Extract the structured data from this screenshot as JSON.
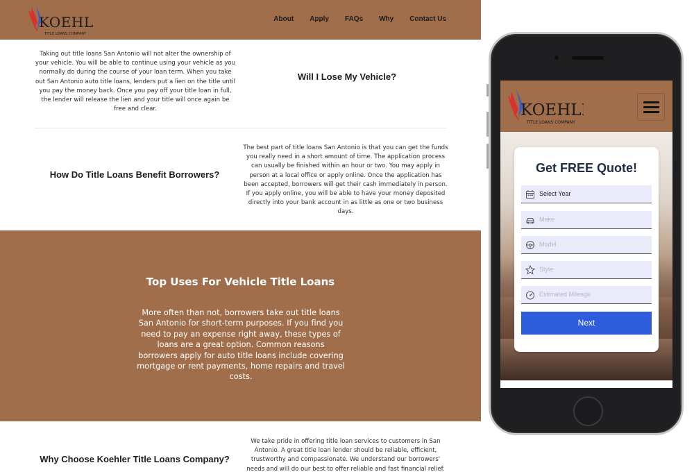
{
  "brand": {
    "logo_text": "KOEHLER",
    "logo_subtext": "TITLE LOANS COMPANY",
    "primary_color": "#a06e4b",
    "accent_red": "#d9322a",
    "accent_blue": "#3c5fc7"
  },
  "nav": {
    "items": [
      "About",
      "Apply",
      "FAQs",
      "Why",
      "Contact Us"
    ]
  },
  "sections": {
    "lose_vehicle": {
      "heading": "Will I Lose My Vehicle?",
      "text": "Taking out title loans San Antonio will not alter the ownership of your vehicle. You will be able to continue using your vehicle as you normally do during the course of your loan term. When you take out San Antonio auto title loans, lenders put a lien on the title until you pay the money back. Once you pay off your title loan in full, the lender will release the lien and your title will once again be free and clear."
    },
    "benefit": {
      "heading": "How Do Title Loans Benefit Borrowers?",
      "text": "The best part of title loans San Antonio is that you can get the funds you really need in a short amount of time. The application process can usually be finished within an hour or two. You may apply in person at a local office or apply online. Once the application has been accepted, borrowers will get their cash immediately in person. If you apply online, you will be able to have your money deposited directly into your bank account in as little as one or two business days."
    },
    "top_uses": {
      "heading": "Top Uses For Vehicle Title Loans",
      "text": "More often than not, borrowers take out title loans San Antonio for short-term purposes. If you find you need to pay an expense right away, these types of loans are a great option. Common reasons borrowers apply for auto title loans include covering mortgage or rent payments, home repairs and travel costs."
    },
    "why_choose": {
      "heading": "Why Choose Koehler Title Loans Company?",
      "text": "We take pride in offering title loan services to customers in San Antonio. A great title loan lender should be reliable, efficient, trustworthy and compassionate. We understand our borrowers' needs and will do our best to offer reliable and fast financial relief. We present all customers"
    }
  },
  "mobile": {
    "quote_title": "Get FREE Quote!",
    "fields": [
      {
        "icon": "calendar-icon",
        "value": "Select Year",
        "filled": true
      },
      {
        "icon": "car-icon",
        "value": "Make",
        "filled": false
      },
      {
        "icon": "steering-wheel-icon",
        "value": "Model",
        "filled": false
      },
      {
        "icon": "star-icon",
        "value": "Style",
        "filled": false
      },
      {
        "icon": "speedometer-icon",
        "value": "Estimated Mileage",
        "filled": false
      }
    ],
    "next_label": "Next"
  }
}
